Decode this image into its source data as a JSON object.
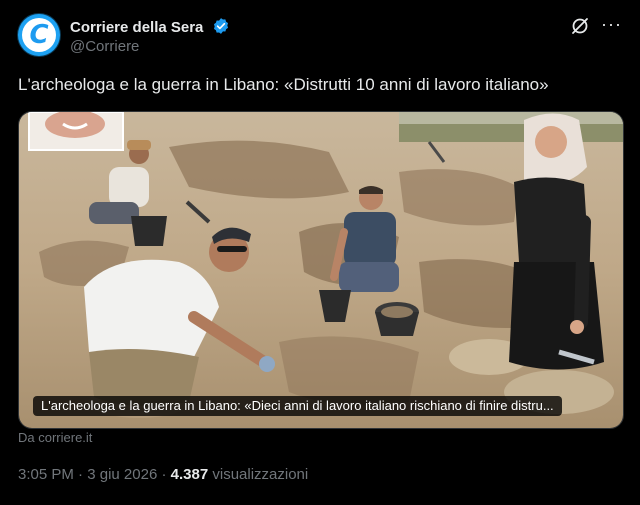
{
  "author": {
    "name": "Corriere della Sera",
    "handle": "@Corriere",
    "avatar_letter": "C",
    "verified": true
  },
  "icons": {
    "grok": "grok-icon",
    "more": "more-icon",
    "verified": "verified-badge-icon"
  },
  "more_label": "···",
  "tweet": {
    "text": "L'archeologa e la guerra in Libano: «Distrutti 10 anni di lavoro italiano»"
  },
  "card": {
    "caption": "L'archeologa e la guerra in Libano: «Dieci anni di lavoro italiano rischiano di finire distru..."
  },
  "source": "Da corriere.it",
  "meta": {
    "time": "3:05 PM",
    "date": "3 giu 2026",
    "separator": "·",
    "views": "4.387",
    "views_label": "visualizzazioni"
  },
  "colors": {
    "background": "#000000",
    "accent": "#1d9bf0",
    "muted": "#71767b"
  }
}
